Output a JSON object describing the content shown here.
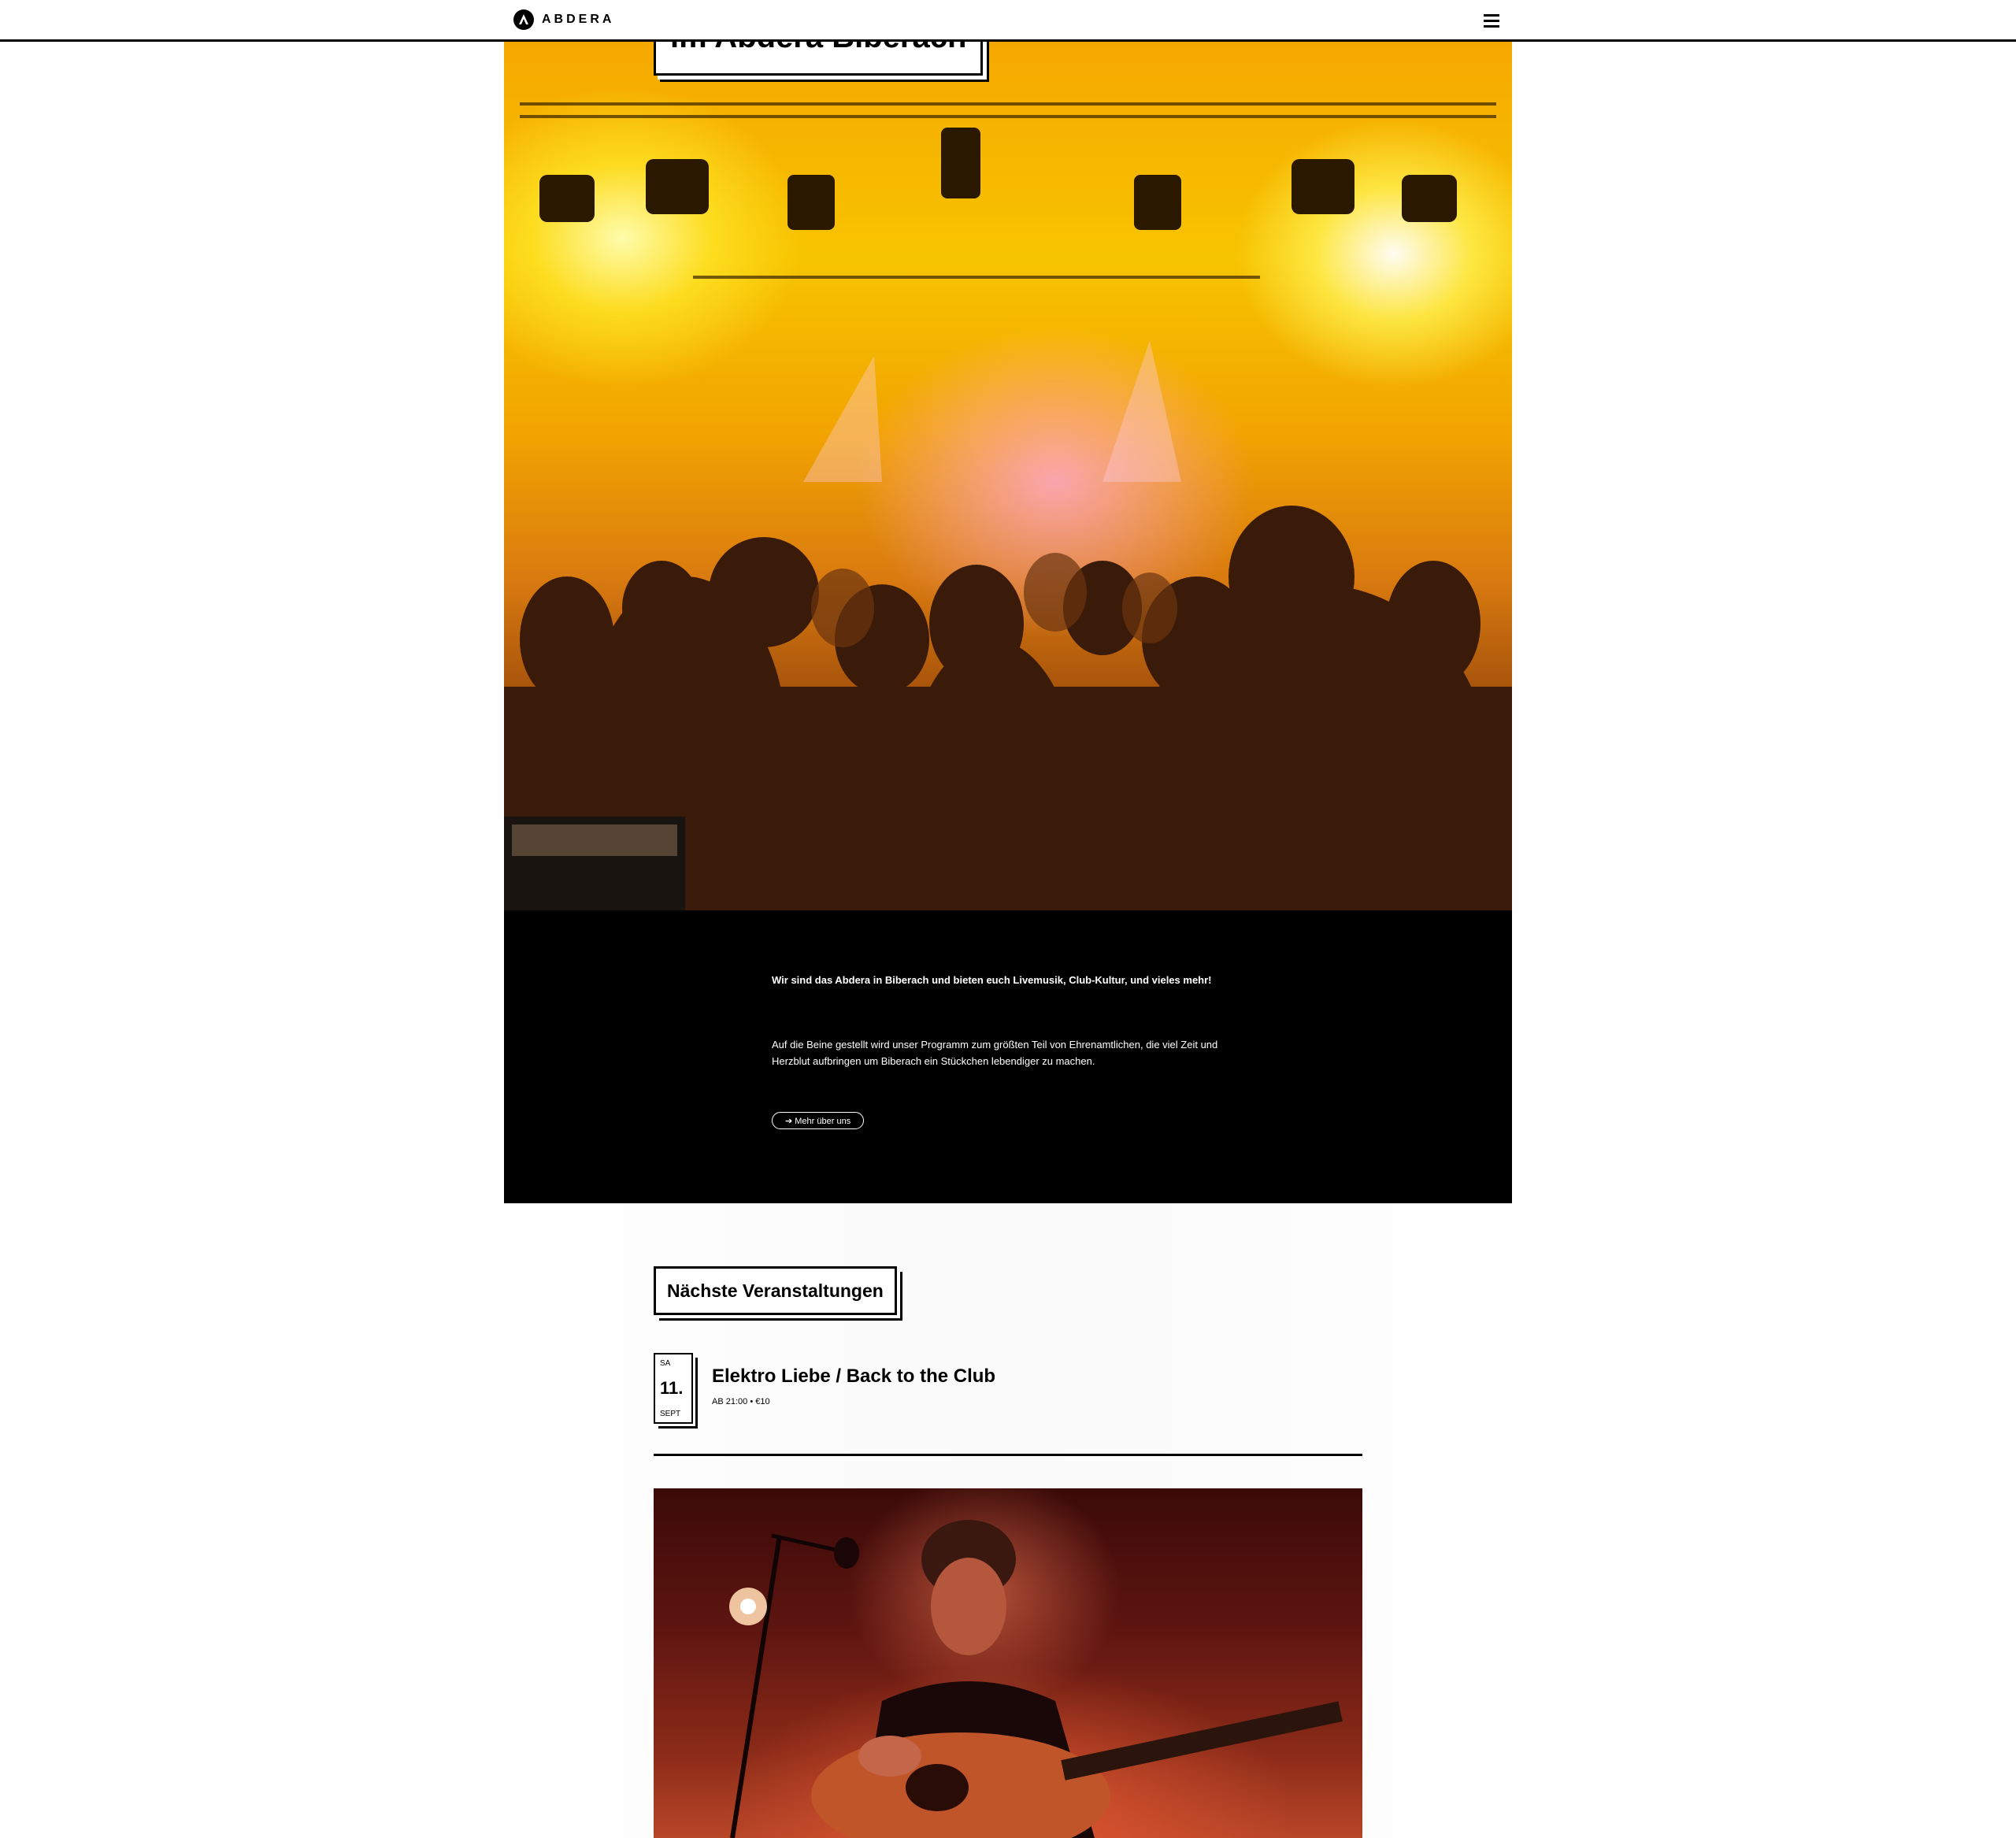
{
  "header": {
    "brand": "ABDERA",
    "logo_icon": "abdera-logo-icon",
    "menu_icon": "hamburger-menu-icon"
  },
  "hero": {
    "title": "im Abdera Biberach",
    "image_description_icon": "concert-crowd-photo"
  },
  "about": {
    "lead": "Wir sind das Abdera in Biberach und bieten euch Livemusik, Club-Kultur, und vieles mehr!",
    "body": "Auf die Beine gestellt wird unser Programm zum größten Teil von Ehrenamtlichen, die viel Zeit und Herzblut aufbringen um Biberach ein Stückchen lebendiger zu machen.",
    "button_label": "➔ Mehr über uns"
  },
  "events": {
    "section_title": "Nächste Veranstaltungen",
    "items": [
      {
        "day_of_week": "SA",
        "day": "11.",
        "month": "SEPT",
        "title": "Elektro Liebe / Back to the Club",
        "meta": "AB 21:00 • €10"
      }
    ]
  },
  "colors": {
    "accent": "#000000",
    "background": "#ffffff",
    "hero_warm": "#f6a800"
  }
}
